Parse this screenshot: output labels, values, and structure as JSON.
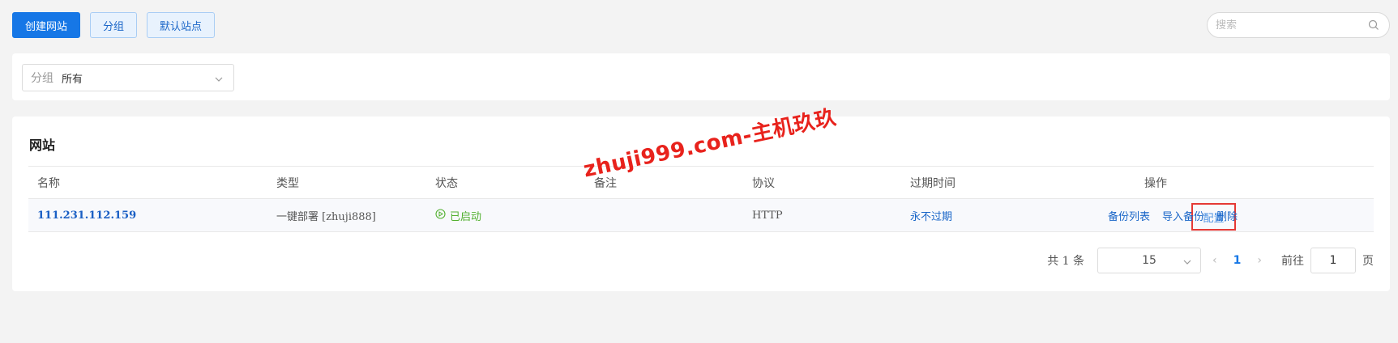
{
  "toolbar": {
    "create_site": "创建网站",
    "group": "分组",
    "default_site": "默认站点"
  },
  "search": {
    "placeholder": "搜索"
  },
  "filter": {
    "label": "分组",
    "value": "所有"
  },
  "sites": {
    "title": "网站",
    "columns": [
      "名称",
      "类型",
      "状态",
      "备注",
      "协议",
      "过期时间",
      "操作"
    ],
    "rows": [
      {
        "name": "111.231.112.159",
        "type": "一键部署 [zhuji888]",
        "status": "已启动",
        "remark": "",
        "protocol": "HTTP",
        "expiry": "永不过期",
        "actions": [
          "配置",
          "备份列表",
          "导入备份",
          "删除"
        ]
      }
    ]
  },
  "pagination": {
    "total": "共 1 条",
    "page_size": "15",
    "current_page": "1",
    "goto_label": "前往",
    "goto_value": "1",
    "page_unit": "页"
  },
  "watermark": "zhuji999.com-主机玖玖",
  "colors": {
    "primary": "#1677e6",
    "status_ok": "#52b030",
    "highlight": "#e53935",
    "watermark": "#e8221c"
  }
}
